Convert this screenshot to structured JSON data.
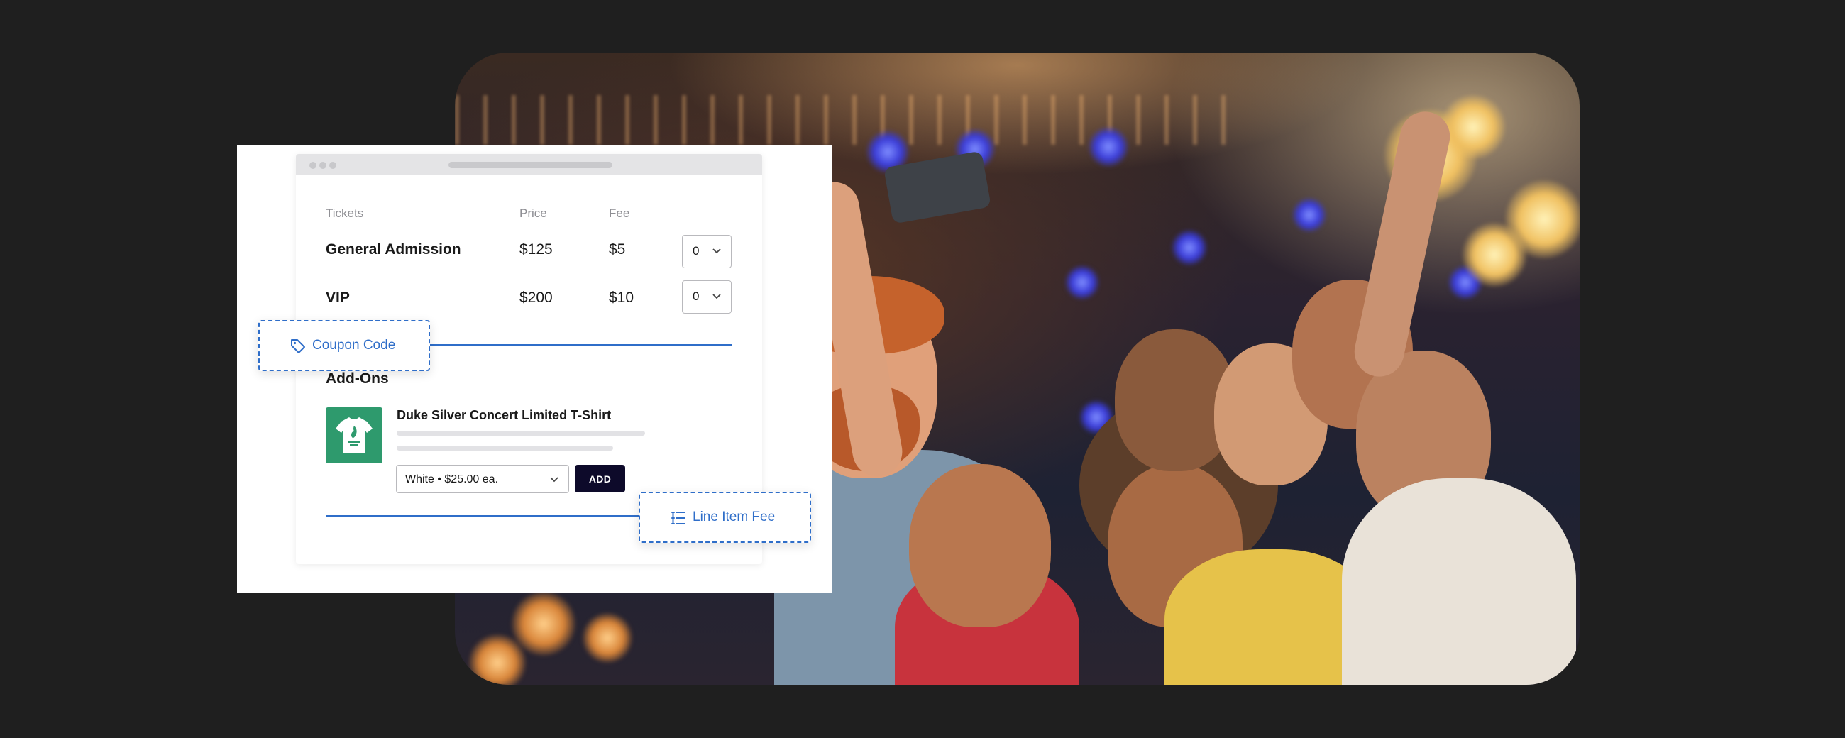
{
  "tickets": {
    "headers": {
      "name": "Tickets",
      "price": "Price",
      "fee": "Fee"
    },
    "rows": [
      {
        "name": "General Admission",
        "price": "$125",
        "fee": "$5",
        "quantity": "0"
      },
      {
        "name": "VIP",
        "price": "$200",
        "fee": "$10",
        "quantity": "0"
      }
    ]
  },
  "coupon": {
    "label": "Coupon Code",
    "icon": "tag-icon"
  },
  "addons": {
    "title": "Add-Ons",
    "item": {
      "name": "Duke Silver Concert Limited T-Shirt",
      "option": "White • $25.00 ea.",
      "add_label": "ADD",
      "icon": "t-shirt-icon"
    }
  },
  "line_item_fee": {
    "label": "Line Item Fee",
    "icon": "list-icon"
  },
  "colors": {
    "accent": "#2f6ec9",
    "button": "#0d0a2a",
    "thumbnail": "#2e9a6d",
    "background": "#1f1f1f"
  }
}
